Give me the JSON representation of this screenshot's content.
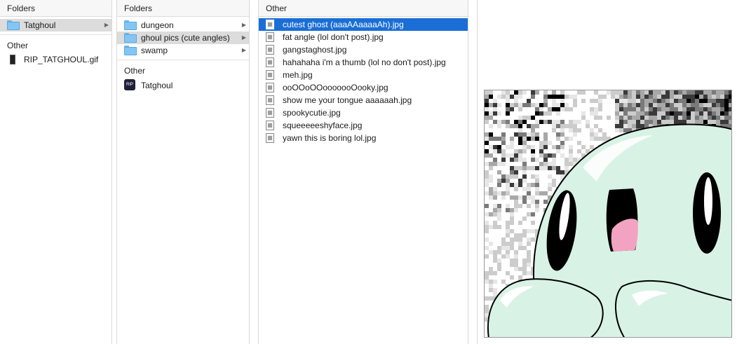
{
  "col1": {
    "header": "Folders",
    "folders": [
      {
        "label": "Tatghoul"
      }
    ],
    "other_header": "Other",
    "other_items": [
      {
        "label": "RIP_TATGHOUL.gif"
      }
    ]
  },
  "col2": {
    "header": "Folders",
    "folders": [
      {
        "label": "dungeon"
      },
      {
        "label": "ghoul pics (cute angles)"
      },
      {
        "label": "swamp"
      }
    ],
    "other_header": "Other",
    "other_items": [
      {
        "label": "Tatghoul",
        "icon_text": "RIP"
      }
    ]
  },
  "col3": {
    "header": "Other",
    "files": [
      {
        "label": "cutest ghost (aaaAAaaaaAh).jpg"
      },
      {
        "label": "fat angle (lol don't post).jpg"
      },
      {
        "label": "gangstaghost.jpg"
      },
      {
        "label": "hahahaha i'm a thumb (lol no don't post).jpg"
      },
      {
        "label": "meh.jpg"
      },
      {
        "label": "ooOOoOOooooooOooky.jpg"
      },
      {
        "label": "show me your tongue aaaaaah.jpg"
      },
      {
        "label": "spookycutie.jpg"
      },
      {
        "label": "squeeeeeshyface.jpg"
      },
      {
        "label": "yawn this is boring lol.jpg"
      }
    ]
  },
  "colors": {
    "selection_blue": "#1a6ed6",
    "selection_gray": "#dcdcdc",
    "folder_blue": "#84c6f3",
    "ghost_mint": "#d9f2e6",
    "tongue_pink": "#f2a3c2"
  }
}
